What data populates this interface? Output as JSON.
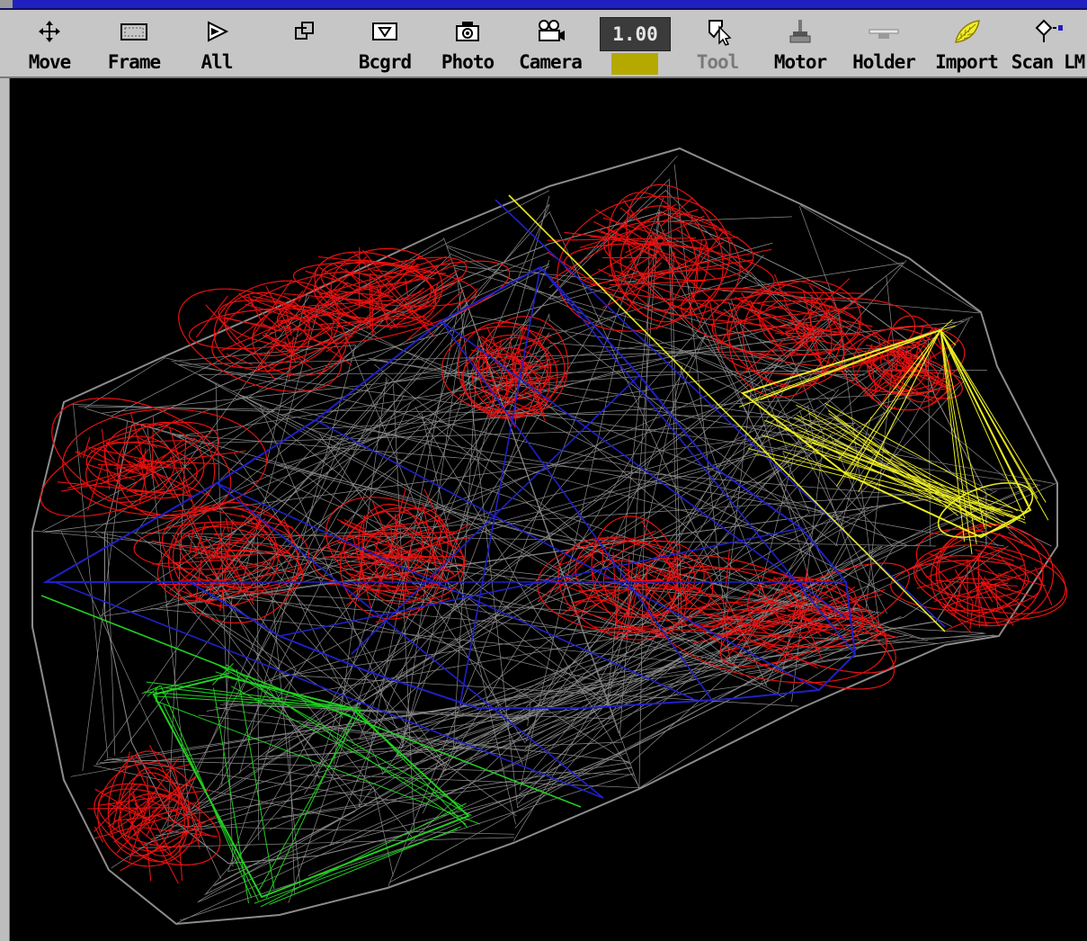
{
  "toolbar": {
    "move_label": "Move",
    "frame_label": "Frame",
    "all_label": "All",
    "bcgrd_label": "Bcgrd",
    "photo_label": "Photo",
    "camera_label": "Camera",
    "zoom_value": "1.00",
    "tool_label": "Tool",
    "motor_label": "Motor",
    "holder_label": "Holder",
    "import_label": "Import",
    "scanlm_label": "Scan LM"
  },
  "colors": {
    "swatch": "#b5a900",
    "title_bar": "#2020c0",
    "wire_body": "#8c8c8c",
    "wire_red": "#e81010",
    "wire_blue": "#2020c8",
    "wire_yellow": "#ecec20",
    "wire_green": "#20d020"
  },
  "icons": {
    "move": "move-arrows-icon",
    "frame": "frame-rect-icon",
    "all": "play-all-icon",
    "layers": "layers-icon",
    "bcgrd": "background-icon",
    "photo": "photo-icon",
    "camera": "camera-icon",
    "tool": "tool-cursor-icon",
    "motor": "motor-icon",
    "holder": "holder-icon",
    "import": "import-leaf-icon",
    "scanlm": "scan-diamond-icon"
  }
}
